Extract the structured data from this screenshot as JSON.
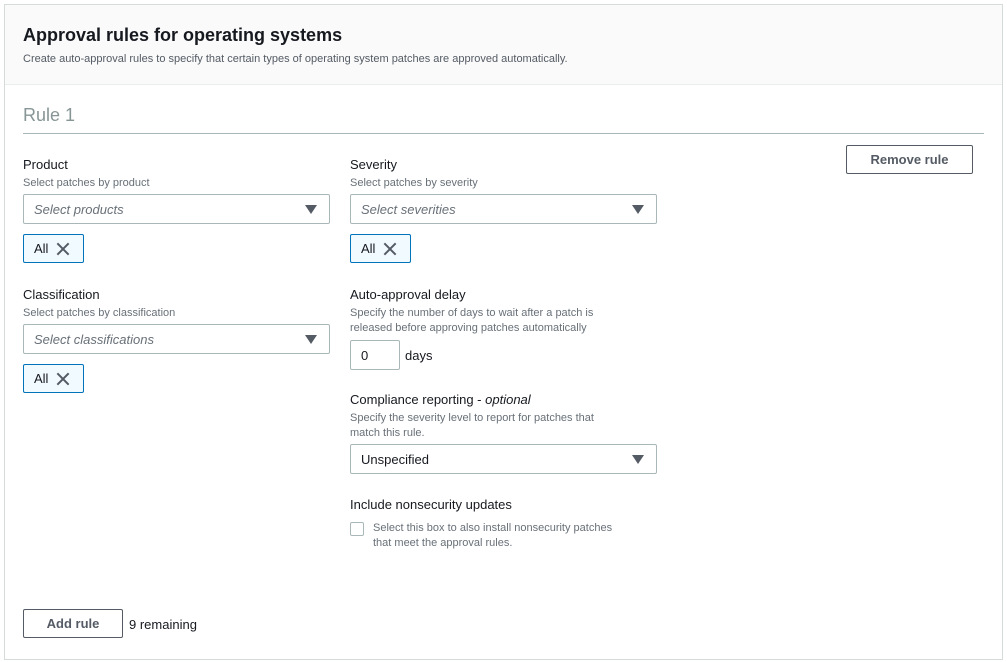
{
  "header": {
    "title": "Approval rules for operating systems",
    "description": "Create auto-approval rules to specify that certain types of operating system patches are approved automatically."
  },
  "rule": {
    "title": "Rule 1",
    "remove_label": "Remove rule",
    "product": {
      "label": "Product",
      "description": "Select patches by product",
      "placeholder": "Select products",
      "tokens": [
        "All"
      ]
    },
    "classification": {
      "label": "Classification",
      "description": "Select patches by classification",
      "placeholder": "Select classifications",
      "tokens": [
        "All"
      ]
    },
    "severity": {
      "label": "Severity",
      "description": "Select patches by severity",
      "placeholder": "Select severities",
      "tokens": [
        "All"
      ]
    },
    "delay": {
      "label": "Auto-approval delay",
      "description_line1": "Specify the number of days to wait after a patch is",
      "description_line2": "released before approving patches automatically",
      "value": "0",
      "unit": "days"
    },
    "compliance": {
      "label": "Compliance reporting - ",
      "optional": "optional",
      "description_line1": "Specify the severity level to report for patches that",
      "description_line2": "match this rule.",
      "selected": "Unspecified"
    },
    "nonsecurity": {
      "label": "Include nonsecurity updates",
      "checked": false,
      "description_line1": "Select this box to also install nonsecurity patches",
      "description_line2": "that meet the approval rules."
    }
  },
  "footer": {
    "add_label": "Add rule",
    "remaining": "9 remaining"
  }
}
